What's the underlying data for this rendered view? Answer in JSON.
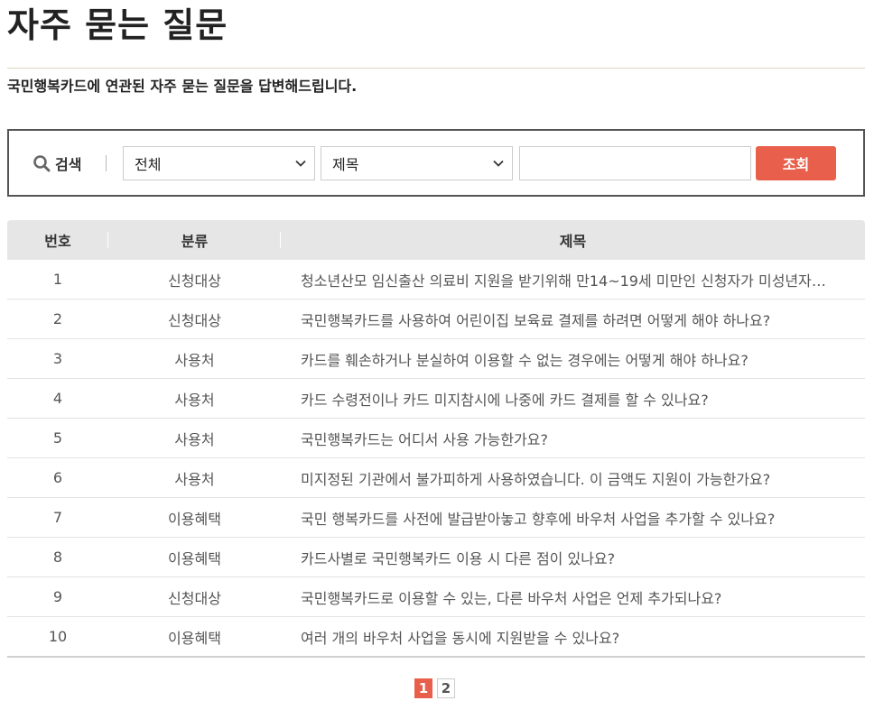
{
  "header": {
    "title": "자주 묻는 질문",
    "subtitle": "국민행복카드에 연관된 자주 묻는 질문을 답변해드립니다."
  },
  "search": {
    "label": "검색",
    "category_select": "전체",
    "field_select": "제목",
    "input_value": "",
    "button_label": "조회",
    "icon": "search-icon"
  },
  "table": {
    "columns": [
      "번호",
      "분류",
      "제목"
    ],
    "rows": [
      {
        "num": "1",
        "category": "신청대상",
        "title": "청소년산모 임신출산 의료비 지원을 받기위해 만14~19세 미만인 신청자가 미성년자라서 부모님의 동의가 필요한가요?"
      },
      {
        "num": "2",
        "category": "신청대상",
        "title": "국민행복카드를 사용하여 어린이집 보육료 결제를 하려면 어떻게 해야 하나요?"
      },
      {
        "num": "3",
        "category": "사용처",
        "title": "카드를 훼손하거나 분실하여 이용할 수 없는 경우에는 어떻게 해야 하나요?"
      },
      {
        "num": "4",
        "category": "사용처",
        "title": "카드 수령전이나 카드 미지참시에 나중에 카드 결제를 할 수 있나요?"
      },
      {
        "num": "5",
        "category": "사용처",
        "title": "국민행복카드는 어디서 사용 가능한가요?"
      },
      {
        "num": "6",
        "category": "사용처",
        "title": "미지정된 기관에서 불가피하게 사용하였습니다. 이 금액도 지원이 가능한가요?"
      },
      {
        "num": "7",
        "category": "이용혜택",
        "title": "국민 행복카드를 사전에 발급받아놓고 향후에 바우처 사업을 추가할 수 있나요?"
      },
      {
        "num": "8",
        "category": "이용혜택",
        "title": "카드사별로 국민행복카드 이용 시 다른 점이 있나요?"
      },
      {
        "num": "9",
        "category": "신청대상",
        "title": "국민행복카드로 이용할 수 있는, 다른 바우처 사업은 언제 추가되나요?"
      },
      {
        "num": "10",
        "category": "이용혜택",
        "title": "여러 개의 바우처 사업을 동시에 지원받을 수 있나요?"
      }
    ]
  },
  "pagination": {
    "pages": [
      "1",
      "2"
    ],
    "current": "1"
  },
  "colors": {
    "accent": "#e8604c",
    "header_bg": "#e6e6e6",
    "border": "#555555"
  }
}
